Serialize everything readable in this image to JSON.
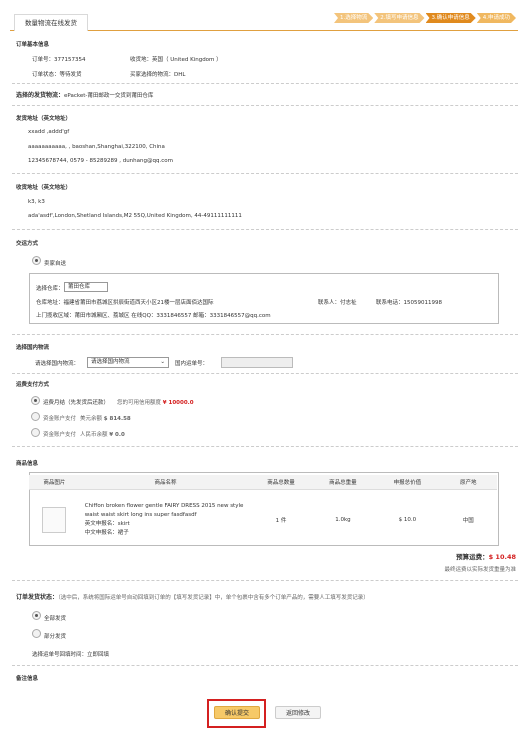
{
  "tab": {
    "label": "数量物流在线发货"
  },
  "steps": [
    "1.选择物流",
    "2.填写申请信息",
    "3.确认申请信息",
    "4.申请成功"
  ],
  "order_info": {
    "title": "订单基本信息",
    "order_no_label": "订单号：",
    "order_no": "377157354",
    "order_status_label": "订单状态：",
    "order_status": "等待发货",
    "receive_country_label": "收货地：",
    "receive_country": "英国（ United Kingdom ）",
    "buyer_logistics_label": "买家选择的物流：",
    "buyer_logistics": "DHL"
  },
  "selected_logistics": {
    "label": "选择的发货物流：",
    "value": "ePacket-莆田邮政一交货到莆田仓库"
  },
  "sender_address": {
    "title": "发货地址（英文地址）",
    "name": "xxadd ,addd'gf",
    "address": "aaaaaaaaaaa, , baoshan,Shanghai,322100, China",
    "contact": "12345678744, 0579 - 85289289 , dunhang@qq.com"
  },
  "receiver_address": {
    "title": "收货地址（英文地址）",
    "name": "k3, k3",
    "address": "ada'asdf',London,Shetland Islands,M2 55Q,United Kingdom, 44-49111111111"
  },
  "delivery_method": {
    "title": "交运方式",
    "option_label": "卖家自送",
    "warehouse_label": "选择仓库：",
    "warehouse_value": "莆田仓库",
    "warehouse_address_label": "仓库地址：",
    "warehouse_address": "福建省莆田市荔城区拱辰街道西天小区21楼一层店面佰达国际",
    "contact_person_label": "联系人：",
    "contact_person": "付志祉",
    "contact_phone_label": "联系电话：",
    "contact_phone": "15059011998",
    "pickup_label": "上门揽收区域：",
    "pickup_area": "莆田市城厢区、荔城区 在线QQ：3331846557 邮箱：3331846557@qq.com"
  },
  "domestic_logistics": {
    "title": "选择国内物流",
    "select_label": "请选择国内物流：",
    "select_value": "请选择国内物流",
    "tracking_label": "国内运单号：",
    "tracking_value": ""
  },
  "payment": {
    "title": "运费支付方式",
    "options": [
      {
        "label": "运费月结（先发货后还款）",
        "extra_label": "您的可用信用额度",
        "extra_value": "¥ 10000.0",
        "selected": true
      },
      {
        "label": "资金账户支付",
        "extra_label": "美元余额",
        "extra_value": "$ 814.58",
        "selected": false
      },
      {
        "label": "资金账户支付",
        "extra_label": "人民币余额",
        "extra_value": "¥ 0.0",
        "selected": false
      }
    ]
  },
  "goods": {
    "title": "商品信息",
    "headers": [
      "商品图片",
      "商品名称",
      "商品总数量",
      "商品总重量",
      "申报总价值",
      "原产地"
    ],
    "rows": [
      {
        "name_en": "Chiffon broken flower gentle FAIRY DRESS 2015 new style waist waist skirt long ins super fasdfasdf",
        "name_en_label": "英文申报名：",
        "name_en_value": "skirt",
        "name_cn_label": "中文申报名：",
        "name_cn_value": "裙子",
        "quantity": "1 件",
        "weight": "1.0kg",
        "value": "$ 10.0",
        "origin": "中国"
      }
    ]
  },
  "estimate": {
    "label": "预算运费：",
    "value": "$ 10.48",
    "note": "最终运费以实际发货重量为准"
  },
  "shipment_status": {
    "title": "订单发货状态：",
    "note": "（选中后，系统将国际运单号自动回填到订单的【填写发货记录】中，单个包裹中含有多个订单产品的，需要人工填写发货记录）",
    "options": [
      {
        "label": "全部发货",
        "selected": true
      },
      {
        "label": "部分发货",
        "selected": false
      }
    ],
    "time_label": "选择运单号回填时间：",
    "time_value": "立即回填"
  },
  "remarks": {
    "title": "备注信息"
  },
  "buttons": {
    "confirm": "确认提交",
    "back": "返回修改"
  },
  "colors": {
    "accent": "#e08a1e",
    "highlight_border": "#d42020",
    "price_red": "#d42020"
  }
}
